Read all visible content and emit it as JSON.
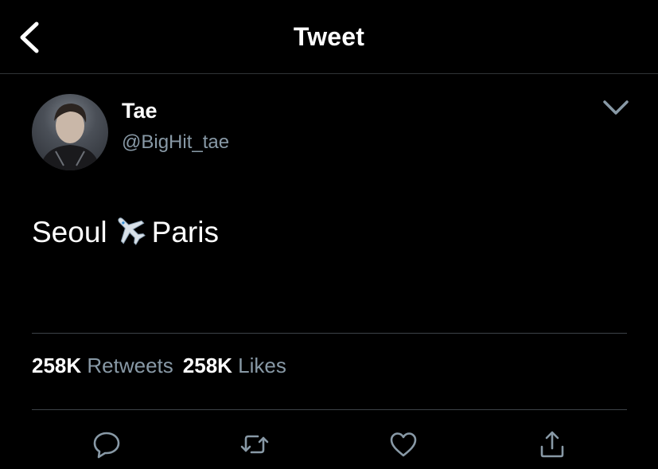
{
  "header": {
    "title": "Tweet",
    "back_icon": "chevron-left-icon"
  },
  "tweet": {
    "author": {
      "display_name": "Tae",
      "handle": "@BigHit_tae"
    },
    "text_before": "Seoul",
    "text_emoji": "airplane-icon",
    "text_after": "Paris",
    "stats": {
      "retweets_count": "258K",
      "retweets_label": "Retweets",
      "likes_count": "258K",
      "likes_label": "Likes"
    },
    "actions": [
      "reply-icon",
      "retweet-icon",
      "like-icon",
      "share-icon"
    ]
  },
  "colors": {
    "background": "#000000",
    "text": "#ffffff",
    "secondary_text": "#8899a6",
    "divider": "#3d4248"
  }
}
